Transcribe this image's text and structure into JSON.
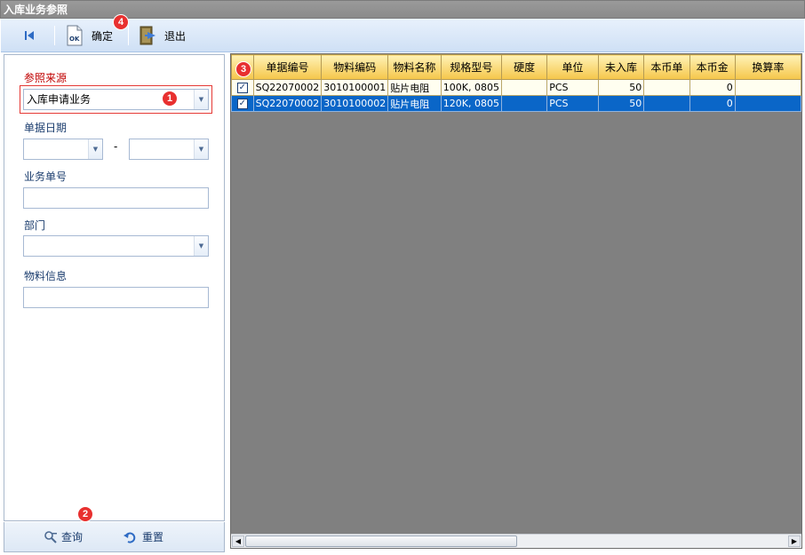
{
  "window": {
    "title": "入库业务参照"
  },
  "toolbar": {
    "first_icon": "first-record-icon",
    "ok_label": "确定",
    "exit_label": "退出"
  },
  "filters": {
    "ref_source_label": "参照来源",
    "ref_source_value": "入库申请业务",
    "date_label": "单据日期",
    "date_sep": "-",
    "biz_no_label": "业务单号",
    "dept_label": "部门",
    "material_label": "物料信息"
  },
  "footer": {
    "query_label": "查询",
    "reset_label": "重置"
  },
  "badges": [
    "1",
    "2",
    "3",
    "4"
  ],
  "grid": {
    "columns": [
      "单据编号",
      "物料编码",
      "物料名称",
      "规格型号",
      "硬度",
      "单位",
      "未入库",
      "本币单",
      "本币金",
      "换算率"
    ],
    "rows": [
      {
        "checked": "✓",
        "doc_no": "SQ22070002",
        "mat_code": "3010100001",
        "mat_name": "贴片电阻",
        "spec": "100K, 0805",
        "hardness": "",
        "unit": "PCS",
        "pending": "50",
        "price": "",
        "amount": "0",
        "rate": ""
      },
      {
        "checked": "✓",
        "doc_no": "SQ22070002",
        "mat_code": "3010100002",
        "mat_name": "贴片电阻",
        "spec": "120K, 0805",
        "hardness": "",
        "unit": "PCS",
        "pending": "50",
        "price": "",
        "amount": "0",
        "rate": ""
      }
    ]
  },
  "colors": {
    "header_gold": "#f5c64a",
    "selected_row": "#0a66c8",
    "badge_red": "#e8302f",
    "label_red": "#c00000"
  }
}
